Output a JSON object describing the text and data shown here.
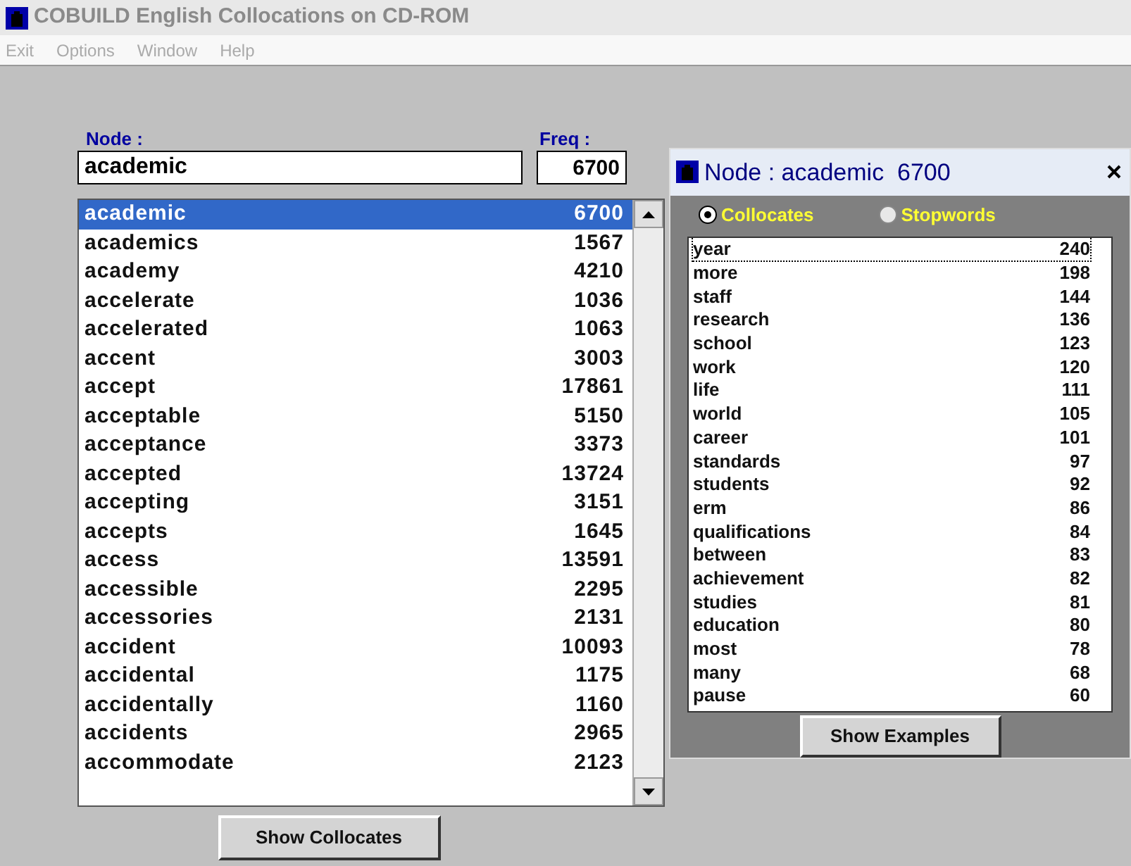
{
  "window": {
    "title": "COBUILD English Collocations on CD-ROM"
  },
  "menu": [
    {
      "label": "Exit",
      "disabled": true
    },
    {
      "label": "Options",
      "disabled": true
    },
    {
      "label": "Window",
      "disabled": true
    },
    {
      "label": "Help",
      "disabled": true
    }
  ],
  "node_label": "Node :",
  "node_field": {
    "value": "academic"
  },
  "freq_label": "Freq :",
  "freq_field": {
    "value": "6700"
  },
  "words": [
    {
      "word": "academic",
      "freq": "6700",
      "selected": true
    },
    {
      "word": "academics",
      "freq": "1567",
      "selected": false
    },
    {
      "word": "academy",
      "freq": "4210",
      "selected": false
    },
    {
      "word": "accelerate",
      "freq": "1036",
      "selected": false
    },
    {
      "word": "accelerated",
      "freq": "1063",
      "selected": false
    },
    {
      "word": "accent",
      "freq": "3003",
      "selected": false
    },
    {
      "word": "accept",
      "freq": "17861",
      "selected": false
    },
    {
      "word": "acceptable",
      "freq": "5150",
      "selected": false
    },
    {
      "word": "acceptance",
      "freq": "3373",
      "selected": false
    },
    {
      "word": "accepted",
      "freq": "13724",
      "selected": false
    },
    {
      "word": "accepting",
      "freq": "3151",
      "selected": false
    },
    {
      "word": "accepts",
      "freq": "1645",
      "selected": false
    },
    {
      "word": "access",
      "freq": "13591",
      "selected": false
    },
    {
      "word": "accessible",
      "freq": "2295",
      "selected": false
    },
    {
      "word": "accessories",
      "freq": "2131",
      "selected": false
    },
    {
      "word": "accident",
      "freq": "10093",
      "selected": false
    },
    {
      "word": "accidental",
      "freq": "1175",
      "selected": false
    },
    {
      "word": "accidentally",
      "freq": "1160",
      "selected": false
    },
    {
      "word": "accidents",
      "freq": "2965",
      "selected": false
    },
    {
      "word": "accommodate",
      "freq": "2123",
      "selected": false
    }
  ],
  "show_collocates": "Show Collocates",
  "popup": {
    "title": "Node : academic  6700",
    "radios": [
      {
        "label": "Collocates",
        "selected": true
      },
      {
        "label": "Stopwords",
        "selected": false
      }
    ],
    "collocates": [
      {
        "word": "year",
        "count": "240",
        "selected": true
      },
      {
        "word": "more",
        "count": "198",
        "selected": false
      },
      {
        "word": "staff",
        "count": "144",
        "selected": false
      },
      {
        "word": "research",
        "count": "136",
        "selected": false
      },
      {
        "word": "school",
        "count": "123",
        "selected": false
      },
      {
        "word": "work",
        "count": "120",
        "selected": false
      },
      {
        "word": "life",
        "count": "111",
        "selected": false
      },
      {
        "word": "world",
        "count": "105",
        "selected": false
      },
      {
        "word": "career",
        "count": "101",
        "selected": false
      },
      {
        "word": "standards",
        "count": "97",
        "selected": false
      },
      {
        "word": "students",
        "count": "92",
        "selected": false
      },
      {
        "word": "erm",
        "count": "86",
        "selected": false
      },
      {
        "word": "qualifications",
        "count": "84",
        "selected": false
      },
      {
        "word": "between",
        "count": "83",
        "selected": false
      },
      {
        "word": "achievement",
        "count": "82",
        "selected": false
      },
      {
        "word": "studies",
        "count": "81",
        "selected": false
      },
      {
        "word": "education",
        "count": "80",
        "selected": false
      },
      {
        "word": "most",
        "count": "78",
        "selected": false
      },
      {
        "word": "many",
        "count": "68",
        "selected": false
      },
      {
        "word": "pause",
        "count": "60",
        "selected": false
      }
    ],
    "button": "Show Examples"
  }
}
